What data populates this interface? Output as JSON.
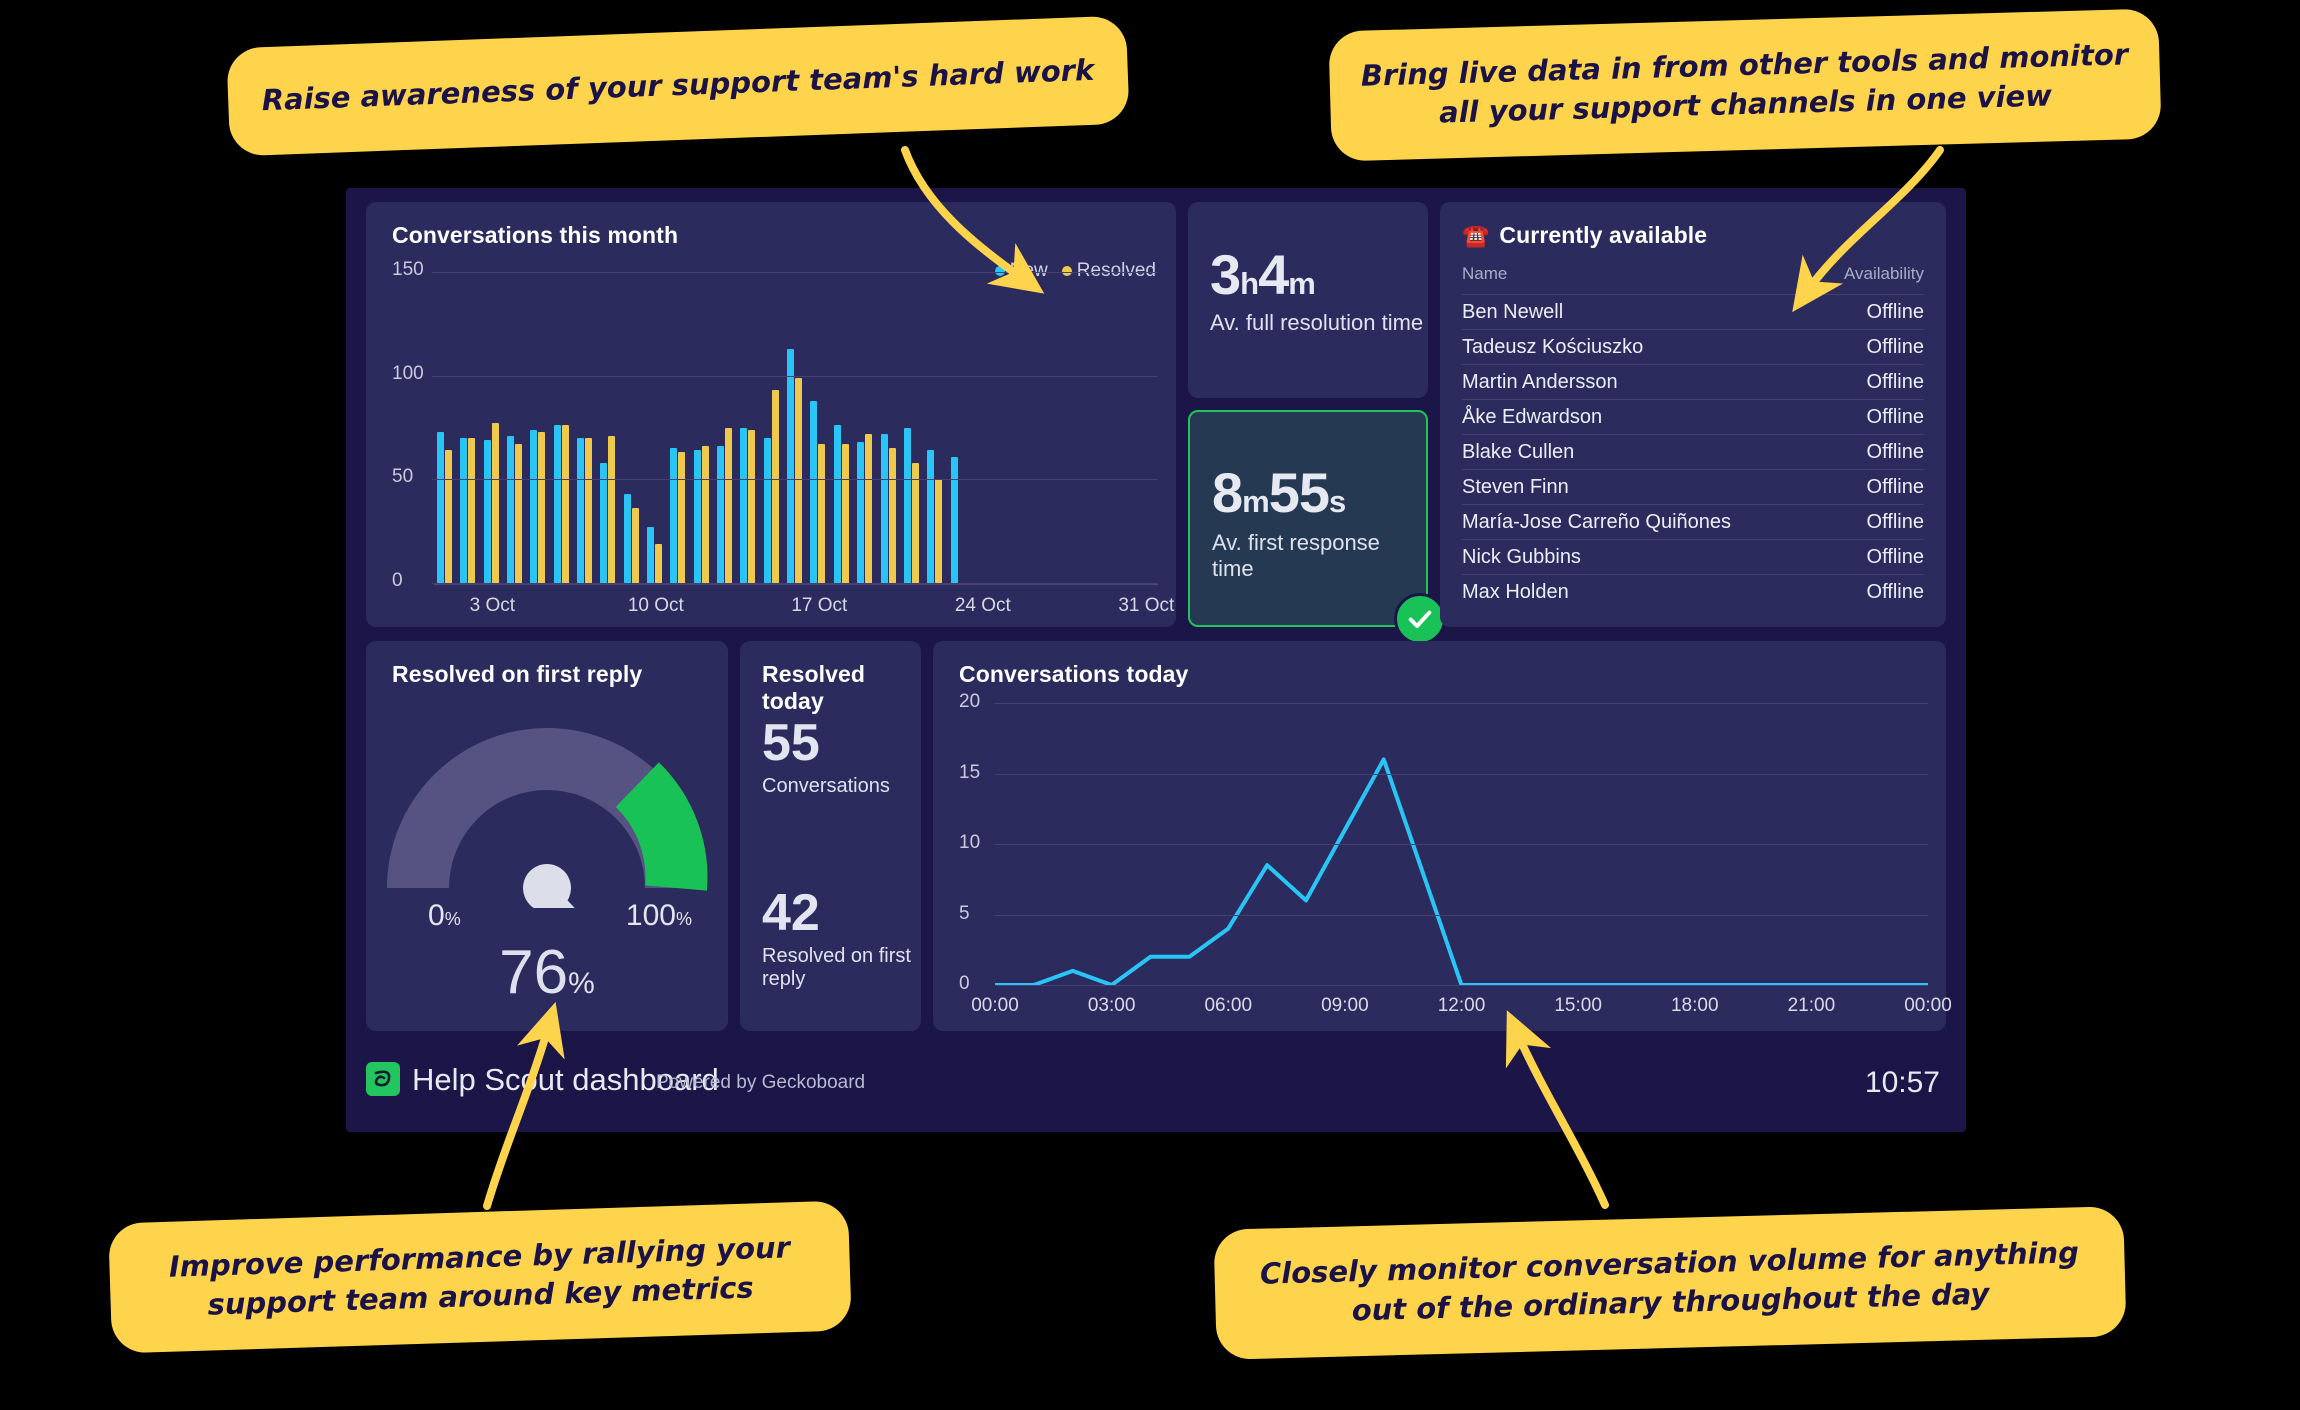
{
  "callouts": [
    {
      "id": "top-left",
      "text": "Raise awareness of your support team's hard work"
    },
    {
      "id": "top-right",
      "text": "Bring live data in from other tools and monitor all your support channels in one view"
    },
    {
      "id": "bottom-left",
      "text": "Improve performance by rallying your support team around key metrics"
    },
    {
      "id": "bottom-right",
      "text": "Closely monitor conversation volume for anything out of the ordinary throughout the day"
    }
  ],
  "colors": {
    "page_background": "#000000",
    "dashboard_background": "#1c1547",
    "widget_background": "#2c2b5e",
    "series_new": "#29c5f6",
    "series_resolved": "#efc94c",
    "accent_green": "#18c257",
    "callout_yellow": "#ffd44d",
    "callout_text": "#1b1246",
    "gauge_track": "#565383",
    "gauge_needle": "#dcdee9"
  },
  "dashboard": {
    "conversations_month": {
      "title": "Conversations this month",
      "legend": [
        {
          "label": "New",
          "color": "#29c5f6"
        },
        {
          "label": "Resolved",
          "color": "#efc94c"
        }
      ]
    },
    "kpi_resolution": {
      "value_number_1": "3",
      "value_unit_1": "h",
      "value_number_2": "4",
      "value_unit_2": "m",
      "caption": "Av. full resolution time"
    },
    "kpi_first_response": {
      "value_number_1": "8",
      "value_unit_1": "m",
      "value_number_2": "55",
      "value_unit_2": "s",
      "caption": "Av. first response time",
      "status_icon": "check-circle-icon"
    },
    "availability": {
      "icon": "telephone-box-icon",
      "title": "Currently available",
      "columns": [
        "Name",
        "Availability"
      ],
      "rows": [
        {
          "name": "Ben Newell",
          "availability": "Offline"
        },
        {
          "name": "Tadeusz Kościuszko",
          "availability": "Offline"
        },
        {
          "name": "Martin Andersson",
          "availability": "Offline"
        },
        {
          "name": "Åke Edwardson",
          "availability": "Offline"
        },
        {
          "name": "Blake Cullen",
          "availability": "Offline"
        },
        {
          "name": "Steven Finn",
          "availability": "Offline"
        },
        {
          "name": "María-Jose Carreño Quiñones",
          "availability": "Offline"
        },
        {
          "name": "Nick Gubbins",
          "availability": "Offline"
        },
        {
          "name": "Max Holden",
          "availability": "Offline"
        }
      ]
    },
    "gauge": {
      "title": "Resolved on first reply",
      "min_label": "0",
      "min_unit": "%",
      "max_label": "100",
      "max_unit": "%",
      "value_label": "76",
      "value_unit": "%"
    },
    "resolved_today": {
      "title": "Resolved today",
      "primary_value": "55",
      "primary_caption": "Conversations",
      "secondary_value": "42",
      "secondary_caption": "Resolved on first reply"
    },
    "conversations_today": {
      "title": "Conversations today"
    },
    "footer": {
      "logo_icon": "help-scout-logo",
      "title": "Help Scout dashboard",
      "powered_by": "Powered by Geckoboard",
      "clock": "10:57"
    }
  },
  "chart_data": [
    {
      "id": "conversations-this-month",
      "type": "bar",
      "title": "Conversations this month",
      "xlabel": "",
      "ylabel": "",
      "ylim": [
        0,
        150
      ],
      "yticks": [
        0,
        50,
        100,
        150
      ],
      "grid": true,
      "legend_position": "top-right",
      "categories": [
        "1 Oct",
        "2 Oct",
        "3 Oct",
        "4 Oct",
        "5 Oct",
        "6 Oct",
        "7 Oct",
        "8 Oct",
        "9 Oct",
        "10 Oct",
        "11 Oct",
        "12 Oct",
        "13 Oct",
        "14 Oct",
        "15 Oct",
        "16 Oct",
        "17 Oct",
        "18 Oct",
        "19 Oct",
        "20 Oct",
        "21 Oct"
      ],
      "xtick_labels": [
        "3 Oct",
        "10 Oct",
        "17 Oct",
        "24 Oct",
        "31 Oct"
      ],
      "xtick_categories": [
        "3 Oct",
        "10 Oct",
        "17 Oct",
        "24 Oct",
        "31 Oct"
      ],
      "axis_days_total": 31,
      "series": [
        {
          "name": "New",
          "color": "#29c5f6",
          "values": [
            73,
            70,
            69,
            71,
            74,
            76,
            70,
            58,
            43,
            27,
            65,
            64,
            66,
            75,
            70,
            113,
            88,
            76,
            68,
            72,
            75,
            64,
            61
          ]
        },
        {
          "name": "Resolved",
          "color": "#efc94c",
          "values": [
            64,
            70,
            77,
            67,
            73,
            76,
            70,
            71,
            36,
            19,
            63,
            66,
            75,
            74,
            93,
            99,
            67,
            67,
            72,
            65,
            58,
            50,
            0
          ]
        }
      ]
    },
    {
      "id": "conversations-today",
      "type": "line",
      "title": "Conversations today",
      "xlabel": "",
      "ylabel": "",
      "ylim": [
        0,
        20
      ],
      "yticks": [
        0,
        5,
        10,
        15,
        20
      ],
      "grid": true,
      "line_color": "#29c5f6",
      "xtick_labels": [
        "00:00",
        "03:00",
        "06:00",
        "09:00",
        "12:00",
        "15:00",
        "18:00",
        "21:00",
        "00:00"
      ],
      "x": [
        "00:00",
        "01:00",
        "02:00",
        "03:00",
        "04:00",
        "05:00",
        "06:00",
        "07:00",
        "08:00",
        "09:00",
        "10:00",
        "11:00",
        "12:00",
        "13:00",
        "14:00",
        "15:00",
        "16:00",
        "17:00",
        "18:00",
        "19:00",
        "20:00",
        "21:00",
        "22:00",
        "23:00",
        "00:00"
      ],
      "values": [
        0,
        0,
        1,
        0,
        2,
        2,
        4,
        8.5,
        6,
        11,
        16,
        8,
        0,
        0,
        0,
        0,
        0,
        0,
        0,
        0,
        0,
        0,
        0,
        0,
        0
      ]
    },
    {
      "id": "resolved-on-first-reply-gauge",
      "type": "gauge",
      "title": "Resolved on first reply",
      "value": 76,
      "min": 0,
      "max": 100,
      "unit": "%",
      "target_band": {
        "from": 70,
        "to": 100,
        "color": "#18c257"
      }
    }
  ]
}
